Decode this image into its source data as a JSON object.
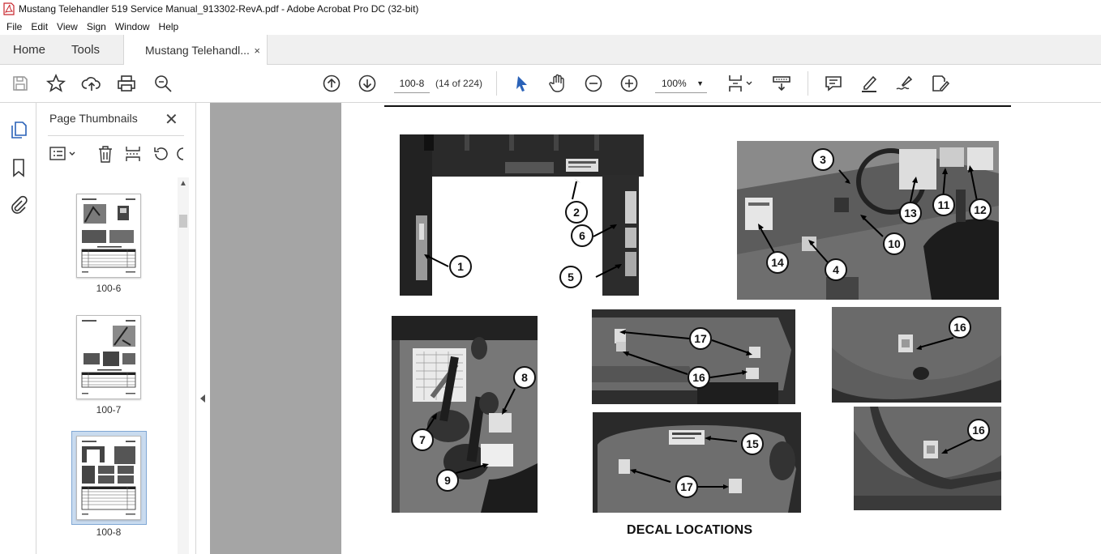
{
  "window": {
    "title": "Mustang Telehandler 519 Service Manual_913302-RevA.pdf - Adobe Acrobat Pro DC (32-bit)"
  },
  "menu": [
    "File",
    "Edit",
    "View",
    "Sign",
    "Window",
    "Help"
  ],
  "tabs": {
    "home": "Home",
    "tools": "Tools",
    "doc": "Mustang Telehandl...",
    "close": "×"
  },
  "toolbar": {
    "page_value": "100-8",
    "page_of": "(14 of 224)",
    "zoom": "100%"
  },
  "thumbnails": {
    "title": "Page Thumbnails",
    "close": "✕",
    "pages": [
      {
        "label": "100-6"
      },
      {
        "label": "100-7"
      },
      {
        "label": "100-8",
        "selected": true
      }
    ]
  },
  "document": {
    "caption": "DECAL LOCATIONS",
    "callouts": [
      "1",
      "2",
      "6",
      "5",
      "3",
      "13",
      "11",
      "12",
      "10",
      "4",
      "14",
      "8",
      "7",
      "9",
      "17",
      "16",
      "15",
      "17",
      "16",
      "16"
    ]
  },
  "colors": {
    "accent": "#2a62b8",
    "tab_bg": "#f0f0f0",
    "doc_bg": "#a5a5a5"
  }
}
